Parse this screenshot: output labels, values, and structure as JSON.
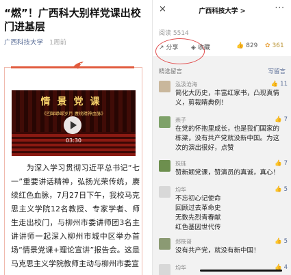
{
  "article": {
    "title": "“燃”！广西科大别样党课出校门进基层",
    "author": "广西科技大学",
    "time": "1周前",
    "video": {
      "title": "情景党课",
      "subtitle": "《回眸峥嵘岁月 赓续精神血脉》",
      "duration": "03:30"
    },
    "body": "　　为深入学习贯彻习近平总书记“七一”重要讲话精神，弘扬光荣传统，赓续红色血脉，7月27日下午，我校马克思主义学院12名教授、专家学者、师生走出校门，与柳州市委讲师团3名主讲讲师一起深入柳州市城中区举办首场“情景党课+理论宣讲”报告会。这是马克思主义学院教师主动与柳州市委宣"
  },
  "panel": {
    "close_icon": "×",
    "title": "广西科技大学 >",
    "more_icon": "···",
    "read": "阅读 5514",
    "share": "分享",
    "favorite": "收藏",
    "like_count": "829",
    "zan_count": "361",
    "comments_label": "精选留言",
    "write_comment": "写留言",
    "comments": [
      {
        "name": "泓汲沧海",
        "likes": "11",
        "text": "简化大历史，丰富红家书，凸现真情义，剪裁睛典例！",
        "avatar_color": "#c9b79c"
      },
      {
        "name": "燕子",
        "likes": "7",
        "text": "在党的怀抱里成长，也是我们国家的栋梁，没有共产党就没新中国。为这次的演出很好，点赞",
        "avatar_color": "#7fa26a"
      },
      {
        "name": "珠珠",
        "likes": "7",
        "text": "赞新颖党课，赞演员的真诚，真心！",
        "avatar_color": "#6d8f4e"
      },
      {
        "name": "均华",
        "likes": "5",
        "text": "不忘初心记使命\n回顾过去革命史\n无数先烈青春献\n红色基因世代传",
        "avatar_color": "#d8d8d8"
      },
      {
        "name": "郑筷哥",
        "likes": "5",
        "text": "没有共产党，就没有新中国！",
        "avatar_color": "#8b9a73"
      },
      {
        "name": "均华",
        "likes": "4",
        "text": "",
        "avatar_color": "#d8d8d8"
      }
    ]
  }
}
